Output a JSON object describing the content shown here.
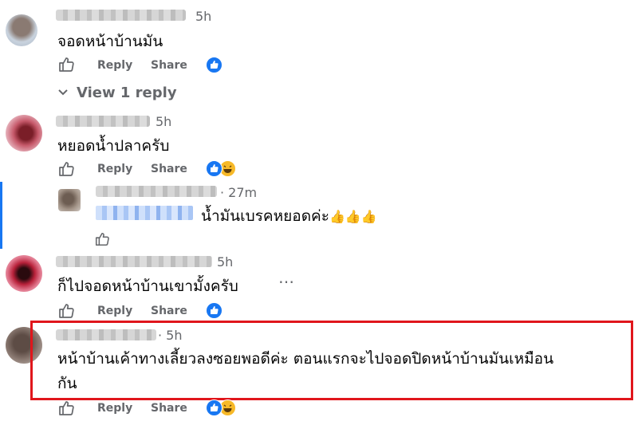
{
  "comments": [
    {
      "time": "5h",
      "text": "จอดหน้าบ้านมัน",
      "actions": {
        "reply": "Reply",
        "share": "Share"
      },
      "view_replies": "View 1 reply"
    },
    {
      "time": "5h",
      "text": "หยอดน้ำปลาครับ",
      "actions": {
        "reply": "Reply",
        "share": "Share"
      },
      "reply": {
        "time": "· 27m",
        "text": "น้ำมันเบรคหยอดค่ะ",
        "emoji": "👍👍👍"
      }
    },
    {
      "time": "5h",
      "text": "ก็ไปจอดหน้าบ้านเขามั้งครับ",
      "more": "…",
      "actions": {
        "reply": "Reply",
        "share": "Share"
      }
    },
    {
      "time": "· 5h",
      "text_line1": "หน้าบ้านเค้าทางเลี้ยวลงซอยพอดีค่ะ ตอนแรกจะไปจอดปิดหน้าบ้านมันเหมือน",
      "text_line2": "กัน",
      "actions": {
        "reply": "Reply",
        "share": "Share"
      }
    }
  ],
  "colors": {
    "accent": "#1877f2",
    "highlight": "#e0161c",
    "muted": "#65676b"
  },
  "icons": [
    "like-outline-icon",
    "like-reaction-icon",
    "haha-reaction-icon",
    "chevron-down-icon"
  ]
}
